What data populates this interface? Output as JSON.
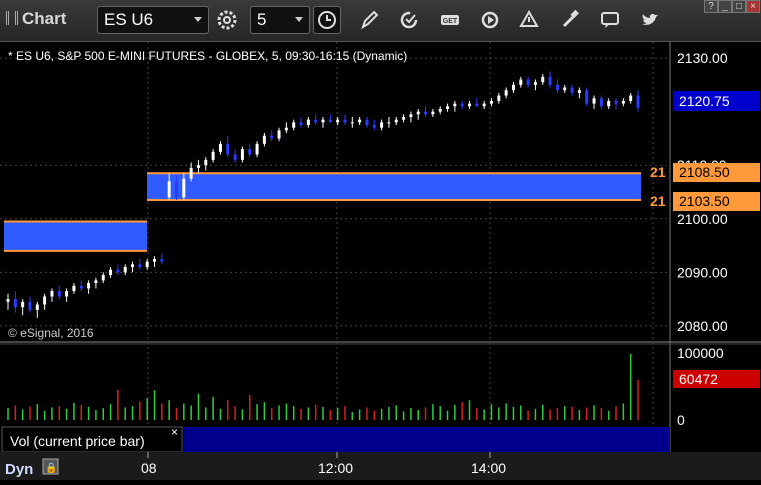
{
  "toolbar": {
    "app_title": "Chart",
    "symbol": "ES U6",
    "interval": "5"
  },
  "window_controls": [
    "?",
    "_",
    "□",
    "×"
  ],
  "chart": {
    "header": "* ES U6, S&P 500 E-MINI FUTURES - GLOBEX, 5, 09:30-16:15 (Dynamic)",
    "copyright": "© eSignal, 2016",
    "price_axis_ticks": [
      "2130.00",
      "2110.00",
      "2100.00",
      "2090.00",
      "2080.00"
    ],
    "current_price_label": "2120.75",
    "current_price_color": "#0000cc",
    "zone_upper_label": "2108.50",
    "zone_lower_label": "2103.50",
    "zone_left_tag": "21",
    "zone_color": "#2f5bff",
    "zone_border_color": "#ff9a3c",
    "volume_axis_ticks": [
      "100000",
      "0"
    ],
    "volume_current_label": "60472",
    "volume_current_color": "#cc0000",
    "volume_panel_label": "Vol (current price bar)",
    "time_axis_labels": [
      "08",
      "12:00",
      "14:00"
    ],
    "bottom_left_label": "Dyn"
  },
  "chart_data": {
    "type": "candlestick",
    "ylim": [
      2077,
      2133
    ],
    "candles": [
      {
        "o": 2084.5,
        "h": 2086.0,
        "l": 2083.0,
        "c": 2085.0
      },
      {
        "o": 2085.0,
        "h": 2086.5,
        "l": 2082.5,
        "c": 2083.5
      },
      {
        "o": 2083.5,
        "h": 2085.0,
        "l": 2082.0,
        "c": 2084.5
      },
      {
        "o": 2084.5,
        "h": 2085.5,
        "l": 2082.5,
        "c": 2083.0
      },
      {
        "o": 2083.0,
        "h": 2084.5,
        "l": 2081.5,
        "c": 2084.0
      },
      {
        "o": 2084.0,
        "h": 2086.0,
        "l": 2083.0,
        "c": 2085.5
      },
      {
        "o": 2085.5,
        "h": 2087.0,
        "l": 2084.5,
        "c": 2086.5
      },
      {
        "o": 2086.5,
        "h": 2087.5,
        "l": 2085.0,
        "c": 2085.5
      },
      {
        "o": 2085.5,
        "h": 2087.0,
        "l": 2084.5,
        "c": 2086.5
      },
      {
        "o": 2086.5,
        "h": 2088.0,
        "l": 2086.0,
        "c": 2087.5
      },
      {
        "o": 2087.5,
        "h": 2088.5,
        "l": 2086.5,
        "c": 2087.0
      },
      {
        "o": 2087.0,
        "h": 2088.5,
        "l": 2086.0,
        "c": 2088.0
      },
      {
        "o": 2088.0,
        "h": 2089.0,
        "l": 2087.0,
        "c": 2088.5
      },
      {
        "o": 2088.5,
        "h": 2090.0,
        "l": 2088.0,
        "c": 2089.5
      },
      {
        "o": 2089.5,
        "h": 2091.0,
        "l": 2089.0,
        "c": 2090.5
      },
      {
        "o": 2090.5,
        "h": 2091.5,
        "l": 2089.5,
        "c": 2090.0
      },
      {
        "o": 2090.0,
        "h": 2091.5,
        "l": 2089.5,
        "c": 2091.0
      },
      {
        "o": 2091.0,
        "h": 2092.0,
        "l": 2090.0,
        "c": 2091.5
      },
      {
        "o": 2091.5,
        "h": 2092.5,
        "l": 2090.5,
        "c": 2091.0
      },
      {
        "o": 2091.0,
        "h": 2092.5,
        "l": 2090.5,
        "c": 2092.0
      },
      {
        "o": 2092.0,
        "h": 2093.0,
        "l": 2091.0,
        "c": 2092.5
      },
      {
        "o": 2092.5,
        "h": 2093.5,
        "l": 2091.5,
        "c": 2092.0
      },
      {
        "o": 2104.0,
        "h": 2108.5,
        "l": 2103.5,
        "c": 2107.0
      },
      {
        "o": 2107.0,
        "h": 2108.0,
        "l": 2103.5,
        "c": 2104.0
      },
      {
        "o": 2104.0,
        "h": 2108.5,
        "l": 2103.5,
        "c": 2107.5
      },
      {
        "o": 2107.5,
        "h": 2110.5,
        "l": 2107.0,
        "c": 2109.5
      },
      {
        "o": 2109.5,
        "h": 2111.0,
        "l": 2108.5,
        "c": 2110.0
      },
      {
        "o": 2110.0,
        "h": 2111.5,
        "l": 2109.0,
        "c": 2111.0
      },
      {
        "o": 2111.0,
        "h": 2113.0,
        "l": 2110.5,
        "c": 2112.5
      },
      {
        "o": 2112.5,
        "h": 2114.5,
        "l": 2112.0,
        "c": 2114.0
      },
      {
        "o": 2114.0,
        "h": 2115.5,
        "l": 2111.5,
        "c": 2112.0
      },
      {
        "o": 2112.0,
        "h": 2113.0,
        "l": 2110.5,
        "c": 2111.0
      },
      {
        "o": 2111.0,
        "h": 2113.5,
        "l": 2110.5,
        "c": 2113.0
      },
      {
        "o": 2113.0,
        "h": 2114.0,
        "l": 2111.5,
        "c": 2112.0
      },
      {
        "o": 2112.0,
        "h": 2114.5,
        "l": 2111.5,
        "c": 2114.0
      },
      {
        "o": 2114.0,
        "h": 2116.0,
        "l": 2113.5,
        "c": 2115.5
      },
      {
        "o": 2115.5,
        "h": 2116.5,
        "l": 2114.5,
        "c": 2115.0
      },
      {
        "o": 2115.0,
        "h": 2117.0,
        "l": 2114.5,
        "c": 2116.5
      },
      {
        "o": 2116.5,
        "h": 2118.0,
        "l": 2116.0,
        "c": 2117.0
      },
      {
        "o": 2117.0,
        "h": 2118.5,
        "l": 2116.5,
        "c": 2118.0
      },
      {
        "o": 2118.0,
        "h": 2119.0,
        "l": 2117.0,
        "c": 2117.5
      },
      {
        "o": 2117.5,
        "h": 2119.0,
        "l": 2117.0,
        "c": 2118.5
      },
      {
        "o": 2118.5,
        "h": 2119.5,
        "l": 2117.5,
        "c": 2118.0
      },
      {
        "o": 2118.0,
        "h": 2119.0,
        "l": 2117.0,
        "c": 2118.5
      },
      {
        "o": 2118.5,
        "h": 2119.5,
        "l": 2118.0,
        "c": 2118.0
      },
      {
        "o": 2118.0,
        "h": 2119.0,
        "l": 2117.5,
        "c": 2118.5
      },
      {
        "o": 2118.5,
        "h": 2119.5,
        "l": 2117.5,
        "c": 2118.0
      },
      {
        "o": 2118.0,
        "h": 2119.0,
        "l": 2117.0,
        "c": 2118.0
      },
      {
        "o": 2118.0,
        "h": 2119.0,
        "l": 2117.5,
        "c": 2118.5
      },
      {
        "o": 2118.5,
        "h": 2119.0,
        "l": 2117.0,
        "c": 2117.5
      },
      {
        "o": 2117.5,
        "h": 2118.5,
        "l": 2116.5,
        "c": 2117.0
      },
      {
        "o": 2117.0,
        "h": 2118.5,
        "l": 2116.5,
        "c": 2118.0
      },
      {
        "o": 2118.0,
        "h": 2119.0,
        "l": 2117.0,
        "c": 2118.0
      },
      {
        "o": 2118.0,
        "h": 2119.0,
        "l": 2117.5,
        "c": 2118.5
      },
      {
        "o": 2118.5,
        "h": 2119.5,
        "l": 2118.0,
        "c": 2119.0
      },
      {
        "o": 2119.0,
        "h": 2120.0,
        "l": 2118.0,
        "c": 2119.5
      },
      {
        "o": 2119.5,
        "h": 2120.5,
        "l": 2118.5,
        "c": 2120.0
      },
      {
        "o": 2120.0,
        "h": 2121.0,
        "l": 2119.0,
        "c": 2119.5
      },
      {
        "o": 2119.5,
        "h": 2120.5,
        "l": 2119.0,
        "c": 2120.0
      },
      {
        "o": 2120.0,
        "h": 2121.0,
        "l": 2119.5,
        "c": 2120.5
      },
      {
        "o": 2120.5,
        "h": 2121.5,
        "l": 2120.0,
        "c": 2121.0
      },
      {
        "o": 2121.0,
        "h": 2122.0,
        "l": 2120.0,
        "c": 2121.5
      },
      {
        "o": 2121.5,
        "h": 2122.0,
        "l": 2120.5,
        "c": 2121.0
      },
      {
        "o": 2121.0,
        "h": 2122.0,
        "l": 2120.5,
        "c": 2121.5
      },
      {
        "o": 2121.5,
        "h": 2122.5,
        "l": 2121.0,
        "c": 2121.0
      },
      {
        "o": 2121.0,
        "h": 2122.0,
        "l": 2120.5,
        "c": 2121.5
      },
      {
        "o": 2121.5,
        "h": 2122.5,
        "l": 2121.0,
        "c": 2122.0
      },
      {
        "o": 2122.0,
        "h": 2123.5,
        "l": 2121.5,
        "c": 2123.0
      },
      {
        "o": 2123.0,
        "h": 2124.5,
        "l": 2122.5,
        "c": 2124.0
      },
      {
        "o": 2124.0,
        "h": 2125.5,
        "l": 2123.5,
        "c": 2125.0
      },
      {
        "o": 2125.0,
        "h": 2126.5,
        "l": 2124.5,
        "c": 2126.0
      },
      {
        "o": 2126.0,
        "h": 2126.5,
        "l": 2124.5,
        "c": 2125.0
      },
      {
        "o": 2125.0,
        "h": 2126.0,
        "l": 2124.0,
        "c": 2125.5
      },
      {
        "o": 2125.5,
        "h": 2127.0,
        "l": 2125.0,
        "c": 2126.5
      },
      {
        "o": 2126.5,
        "h": 2127.5,
        "l": 2124.5,
        "c": 2125.0
      },
      {
        "o": 2125.0,
        "h": 2126.0,
        "l": 2123.5,
        "c": 2124.0
      },
      {
        "o": 2124.0,
        "h": 2125.0,
        "l": 2123.5,
        "c": 2124.5
      },
      {
        "o": 2124.5,
        "h": 2125.0,
        "l": 2123.0,
        "c": 2123.5
      },
      {
        "o": 2123.5,
        "h": 2124.5,
        "l": 2122.5,
        "c": 2124.0
      },
      {
        "o": 2124.0,
        "h": 2124.5,
        "l": 2121.0,
        "c": 2121.5
      },
      {
        "o": 2121.5,
        "h": 2123.0,
        "l": 2120.5,
        "c": 2122.5
      },
      {
        "o": 2122.5,
        "h": 2123.0,
        "l": 2120.5,
        "c": 2121.0
      },
      {
        "o": 2121.0,
        "h": 2122.5,
        "l": 2120.5,
        "c": 2122.0
      },
      {
        "o": 2122.0,
        "h": 2122.5,
        "l": 2120.5,
        "c": 2121.5
      },
      {
        "o": 2121.5,
        "h": 2122.5,
        "l": 2121.0,
        "c": 2122.0
      },
      {
        "o": 2122.0,
        "h": 2123.5,
        "l": 2121.5,
        "c": 2123.0
      },
      {
        "o": 2123.0,
        "h": 2124.0,
        "l": 2120.0,
        "c": 2120.75
      }
    ],
    "volume": [
      18000,
      22000,
      16000,
      20000,
      24000,
      14000,
      19000,
      21000,
      17000,
      26000,
      23000,
      20000,
      15000,
      18000,
      24000,
      46000,
      19000,
      21000,
      28000,
      33000,
      45000,
      25000,
      30000,
      18000,
      25000,
      22000,
      40000,
      19000,
      35000,
      17000,
      30000,
      21000,
      16000,
      38000,
      24000,
      27000,
      18000,
      22000,
      25000,
      21000,
      17000,
      19000,
      23000,
      20000,
      15000,
      18000,
      21000,
      12000,
      16000,
      19000,
      14000,
      17000,
      20000,
      22000,
      13000,
      18000,
      15000,
      19000,
      24000,
      21000,
      14000,
      23000,
      27000,
      30000,
      18000,
      16000,
      24000,
      19000,
      25000,
      20000,
      22000,
      14000,
      17000,
      23000,
      16000,
      18000,
      21000,
      20000,
      15000,
      19000,
      22000,
      18000,
      14000,
      21000,
      25000,
      100000,
      60472
    ],
    "volume_colors": "alternating green/red by candle direction"
  }
}
